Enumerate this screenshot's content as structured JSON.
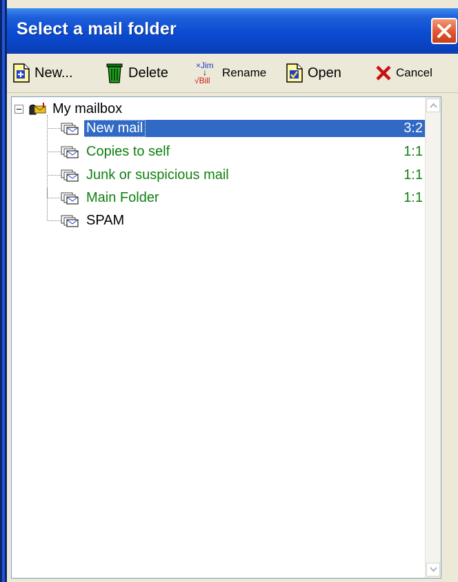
{
  "window": {
    "title": "Select a mail folder"
  },
  "toolbar": {
    "new_label": "New...",
    "delete_label": "Delete",
    "rename_label": "Rename",
    "rename_icon_top": "×Jim",
    "rename_icon_bottom": "√Bill",
    "open_label": "Open",
    "cancel_label": "Cancel"
  },
  "tree": {
    "root_label": "My mailbox",
    "folders": [
      {
        "name": "New mail",
        "count": "3:2",
        "color": "#FFFFFF",
        "selected": true
      },
      {
        "name": "Copies to self",
        "count": "1:1",
        "color": "#108010"
      },
      {
        "name": "Junk or suspicious mail",
        "count": "1:1",
        "color": "#108010"
      },
      {
        "name": "Main Folder",
        "count": "1:1",
        "color": "#108010"
      },
      {
        "name": "SPAM",
        "count": "",
        "color": "#000000"
      }
    ]
  },
  "colors": {
    "selection": "#316AC5",
    "folder_text_green": "#108010",
    "title_bar": "#0B4BD2"
  }
}
